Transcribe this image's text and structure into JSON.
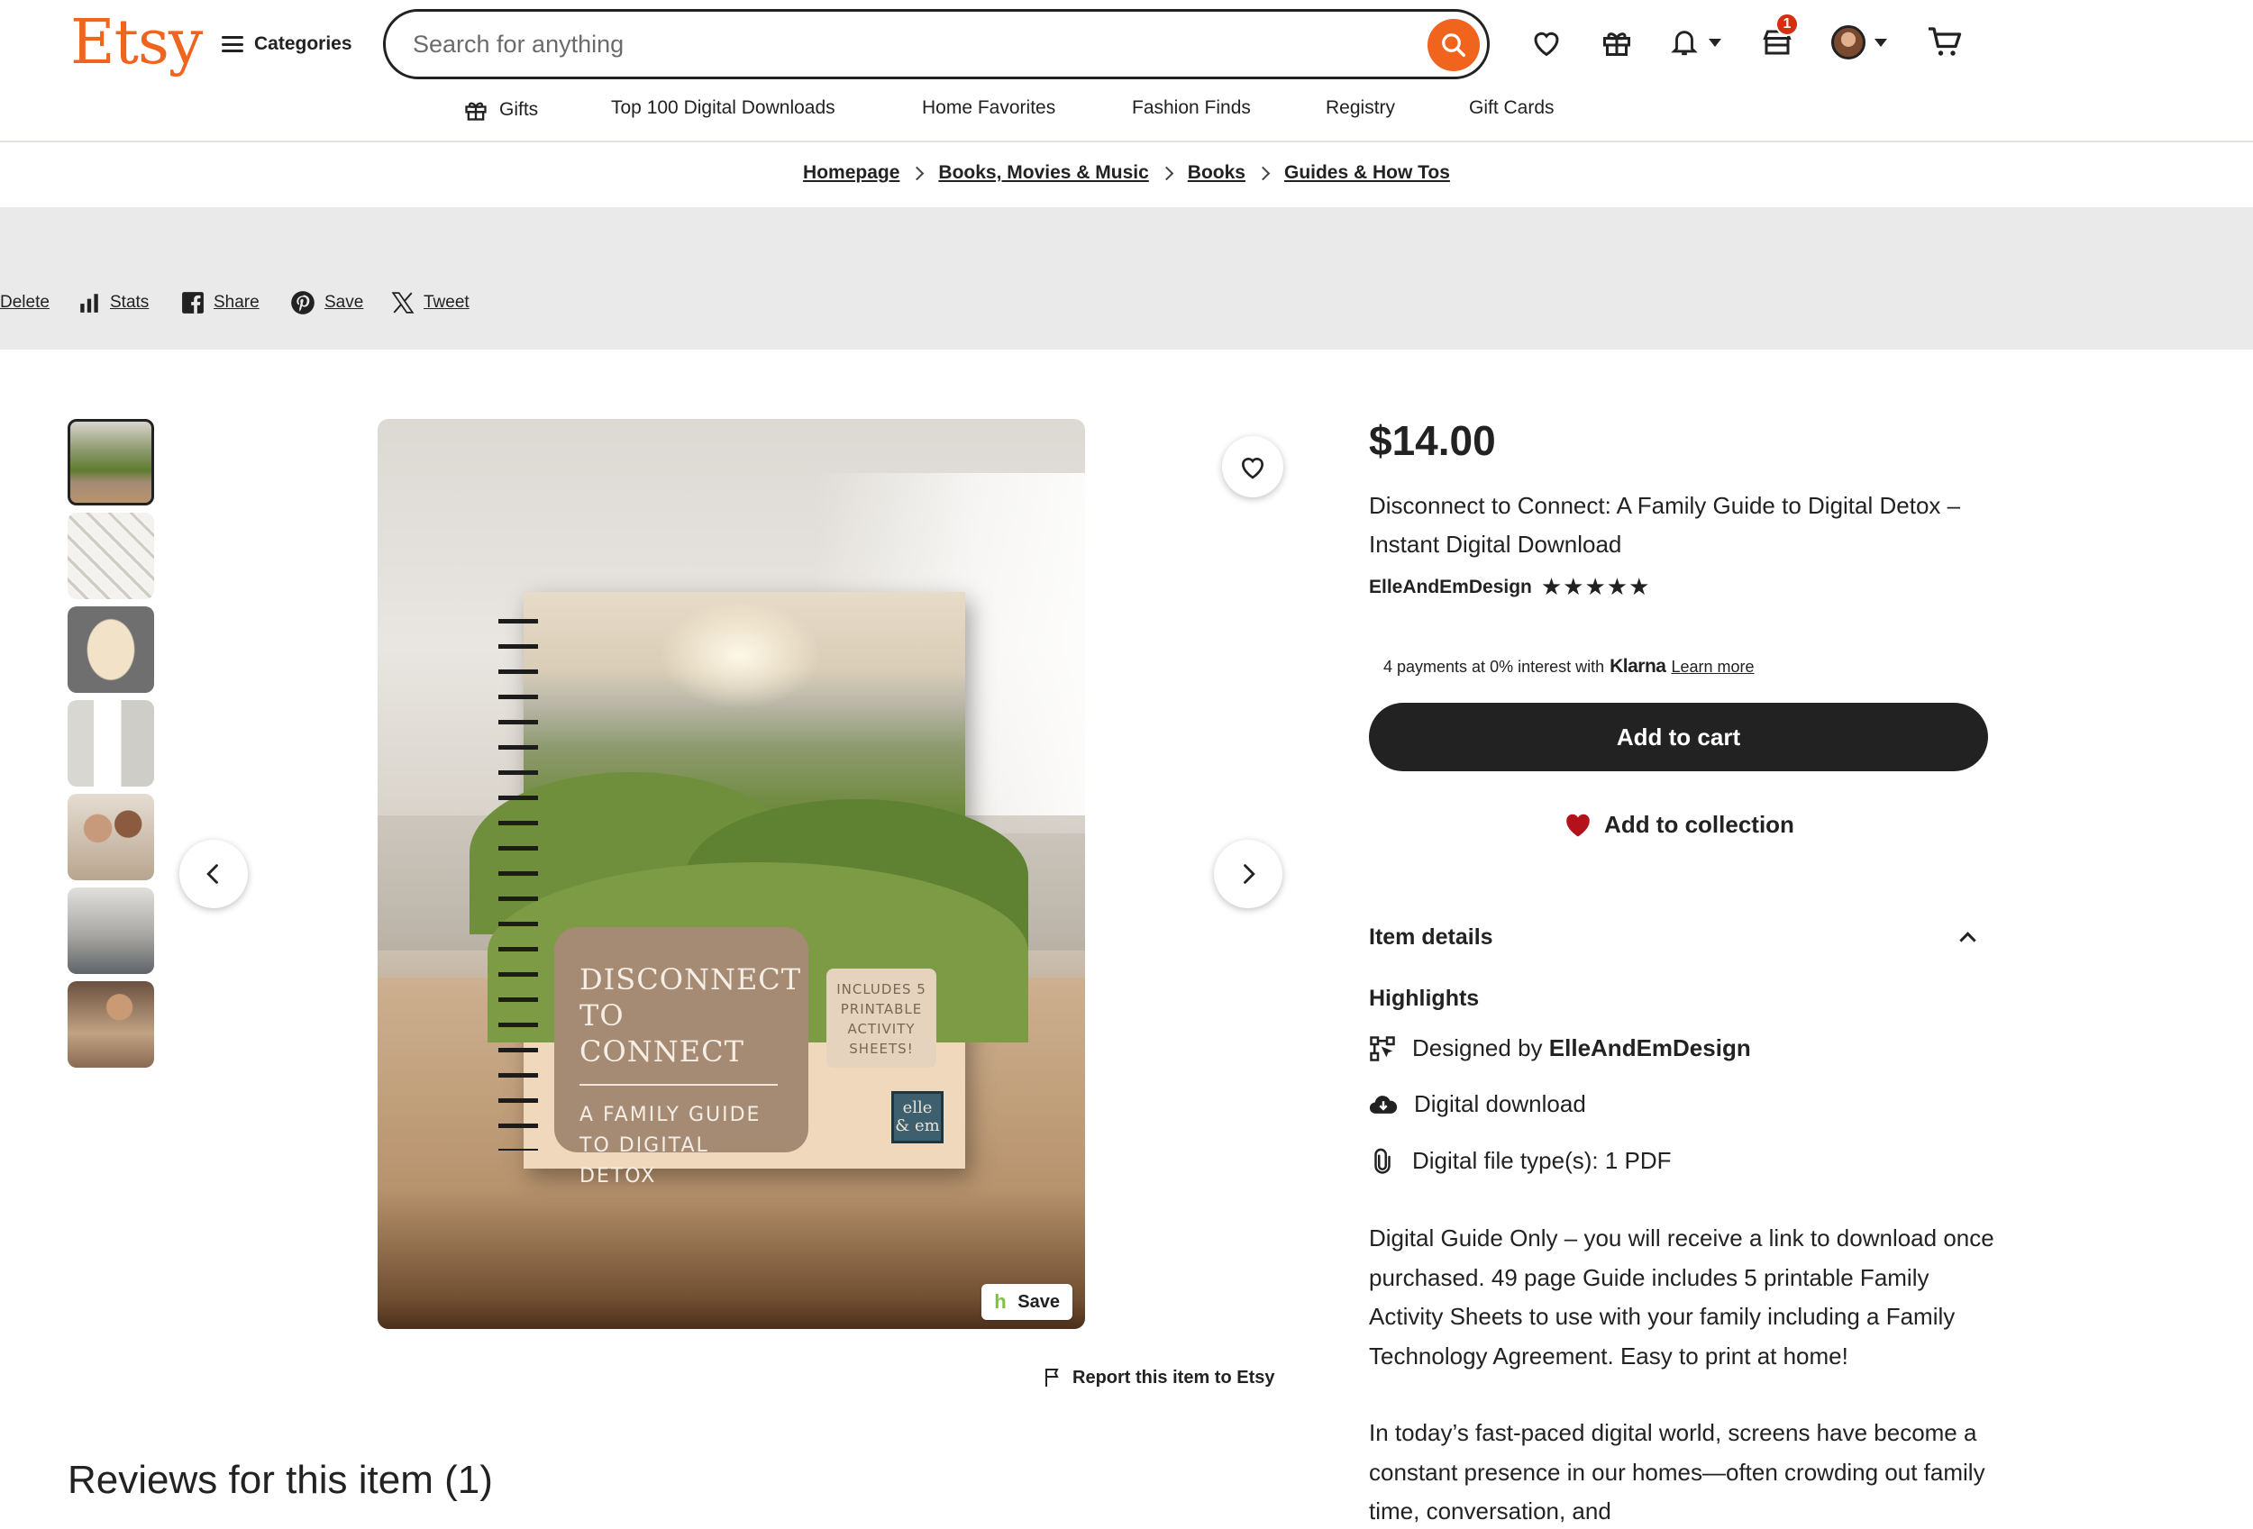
{
  "header": {
    "logo": "Etsy",
    "categories_label": "Categories",
    "search_placeholder": "Search for anything",
    "cart_badge_count": "1",
    "colors": {
      "brand": "#f1641e",
      "badge": "#d4300f",
      "primary_button": "#222222"
    }
  },
  "subnav": [
    {
      "label": "Gifts",
      "icon": "gift-icon"
    },
    {
      "label": "Top 100 Digital Downloads"
    },
    {
      "label": "Home Favorites"
    },
    {
      "label": "Fashion Finds"
    },
    {
      "label": "Registry"
    },
    {
      "label": "Gift Cards"
    }
  ],
  "breadcrumb": [
    "Homepage",
    "Books, Movies & Music",
    "Books",
    "Guides & How Tos"
  ],
  "owner_tools": [
    {
      "label": "Delete"
    },
    {
      "label": "Stats",
      "icon": "bar-chart-icon"
    },
    {
      "label": "Share",
      "icon": "facebook-icon"
    },
    {
      "label": "Save",
      "icon": "pinterest-icon"
    },
    {
      "label": "Tweet",
      "icon": "x-logo-icon"
    }
  ],
  "gallery": {
    "thumbnail_count": 7,
    "active_index": 0,
    "book_cover": {
      "title": "DISCONNECT TO CONNECT",
      "subtitle": "A FAMILY GUIDE TO DIGITAL DETOX",
      "sticker": "INCLUDES 5 PRINTABLE ACTIVITY SHEETS!",
      "brand": "elle & em"
    },
    "save_overlay_label": "Save",
    "report_label": "Report this item to Etsy"
  },
  "reviews_title": "Reviews for this item (1)",
  "product": {
    "price": "$14.00",
    "title": "Disconnect to Connect: A Family Guide to Digital Detox – Instant Digital Download",
    "shop_name": "ElleAndEmDesign",
    "rating_stars": "★★★★★",
    "klarna_text": "4 payments at 0% interest with",
    "klarna_brand": "Klarna",
    "klarna_link": "Learn more",
    "add_to_cart": "Add to cart",
    "add_to_collection": "Add to collection"
  },
  "item_details": {
    "heading": "Item details",
    "highlights_heading": "Highlights",
    "designed_by_prefix": "Designed by",
    "designed_by_shop": "ElleAndEmDesign",
    "digital_download": "Digital download",
    "file_type": "Digital file type(s): 1 PDF",
    "description_1": "Digital Guide Only – you will receive a link to download once purchased. 49 page Guide includes 5 printable Family Activity Sheets to use with your family including a Family Technology Agreement. Easy to print at home!",
    "description_2": "In today’s fast-paced digital world, screens have become a constant presence in our homes—often crowding out family time, conversation, and"
  }
}
